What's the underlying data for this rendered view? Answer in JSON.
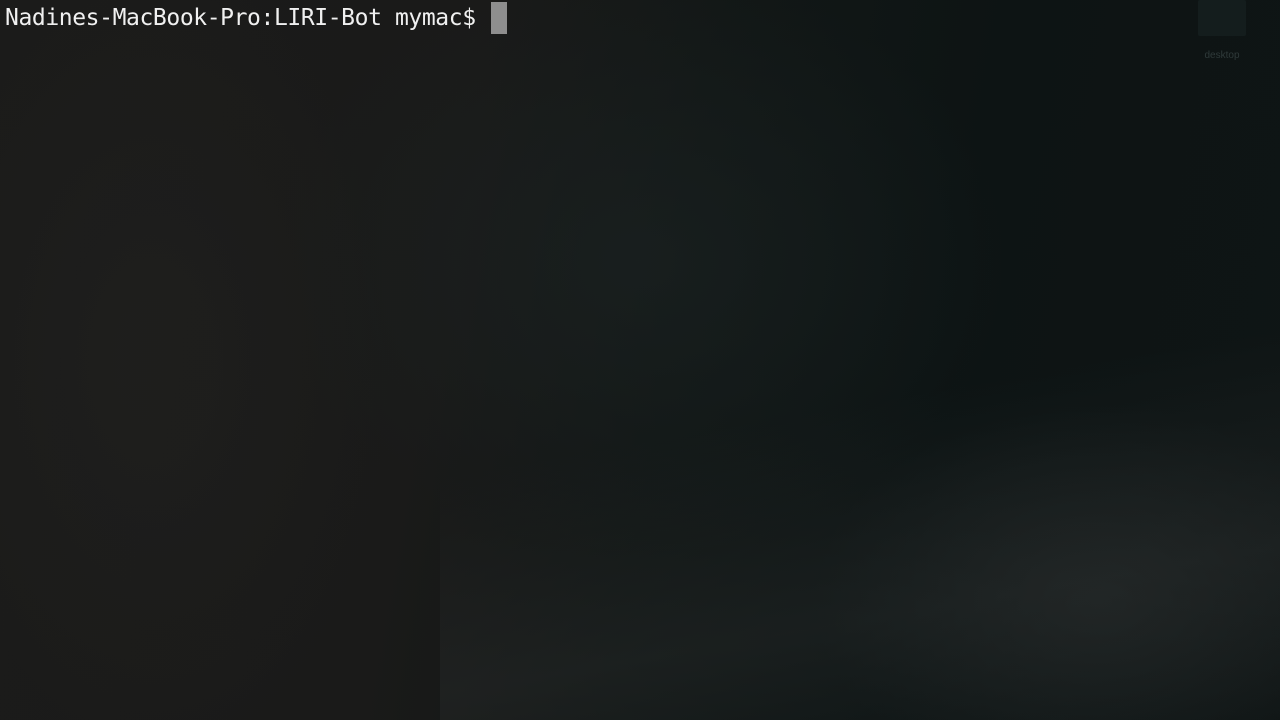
{
  "terminal": {
    "prompt": "Nadines-MacBook-Pro:LIRI-Bot mymac$",
    "input": ""
  },
  "desktop": {
    "icons": [
      {
        "label": "desktop",
        "icon": "folder-icon"
      }
    ]
  },
  "colors": {
    "text": "#f0f0f0",
    "cursor": "#8e8e8e",
    "background": "#141716"
  }
}
